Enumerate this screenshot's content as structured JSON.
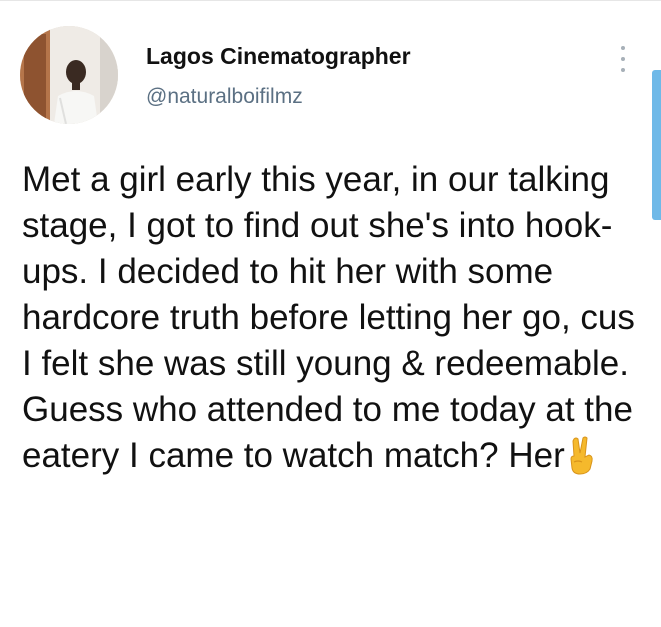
{
  "tweet": {
    "author": {
      "display_name": "Lagos Cinematographer",
      "handle": "@naturalboifilmz"
    },
    "more_icon": "more-vertical-icon",
    "text": "Met a girl early this year, in our talking stage, I got to find out she's into hook-ups. I decided to hit her with some hardcore truth before letting her go, cus I felt she was still young & redeemable. Guess who attended to me today at the eatery I came to watch match? Her",
    "trailing_emoji": "victory-hand-emoji"
  },
  "colors": {
    "text": "#111111",
    "handle": "#5b7083",
    "scroll_indicator": "#6fb9e8",
    "dots": "#a7b0b8"
  }
}
